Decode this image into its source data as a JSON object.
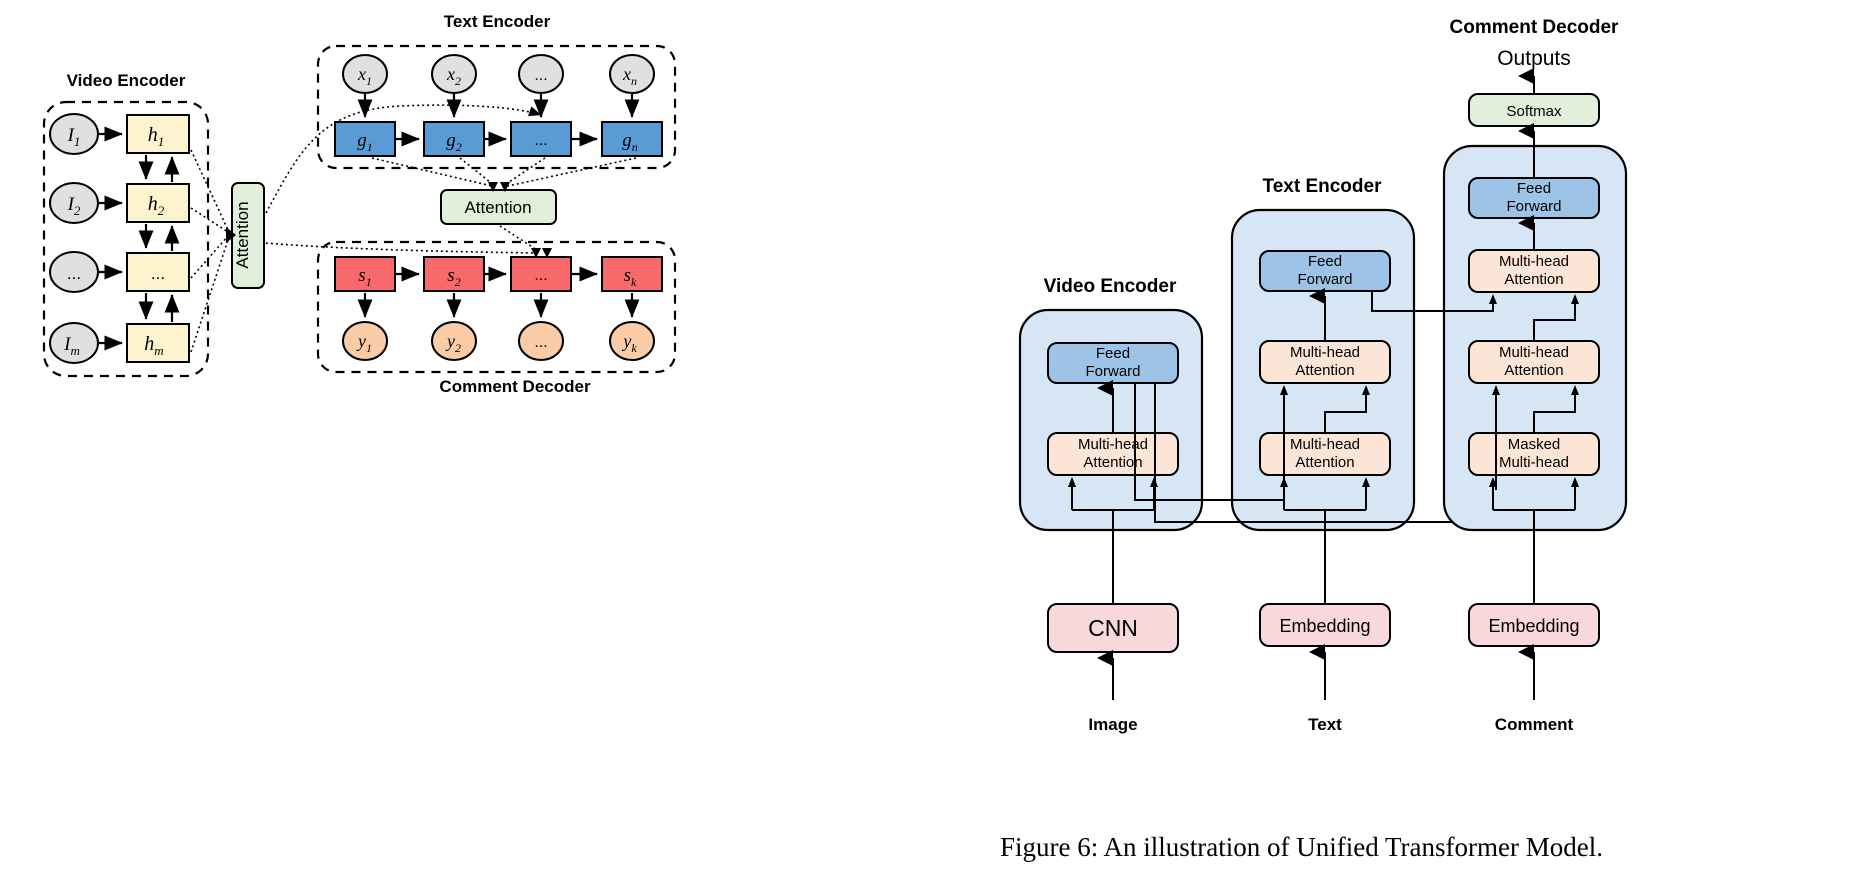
{
  "figure": {
    "caption": "Figure 6: An illustration of Unified Transformer Model."
  },
  "colors": {
    "gray_node": "#e0e0e0",
    "yellow_node": "#fdf3ce",
    "blue_node": "#5b9bd5",
    "red_node": "#f8696b",
    "orange_node": "#f9cba7",
    "green_node": "#e2efda",
    "panel_blue": "#d6e6f5",
    "ff_blue": "#9dc3e6",
    "attn_peach": "#fbe5d6",
    "embed_pink": "#f9d8dc",
    "softmax_green": "#e2efda",
    "stroke": "#000000"
  },
  "left_diagram": {
    "video_encoder": {
      "title": "Video Encoder",
      "inputs": [
        {
          "label": "I",
          "sub": "1"
        },
        {
          "label": "I",
          "sub": "2"
        },
        {
          "label": "...",
          "sub": ""
        },
        {
          "label": "I",
          "sub": "m"
        }
      ],
      "hidden": [
        {
          "label": "h",
          "sub": "1"
        },
        {
          "label": "h",
          "sub": "2"
        },
        {
          "label": "...",
          "sub": ""
        },
        {
          "label": "h",
          "sub": "m"
        }
      ]
    },
    "text_encoder": {
      "title": "Text Encoder",
      "inputs": [
        {
          "label": "x",
          "sub": "1"
        },
        {
          "label": "x",
          "sub": "2"
        },
        {
          "label": "...",
          "sub": ""
        },
        {
          "label": "x",
          "sub": "n"
        }
      ],
      "hidden": [
        {
          "label": "g",
          "sub": "1"
        },
        {
          "label": "g",
          "sub": "2"
        },
        {
          "label": "...",
          "sub": ""
        },
        {
          "label": "g",
          "sub": "n"
        }
      ]
    },
    "comment_decoder": {
      "title": "Comment Decoder",
      "states": [
        {
          "label": "s",
          "sub": "1"
        },
        {
          "label": "s",
          "sub": "2"
        },
        {
          "label": "...",
          "sub": ""
        },
        {
          "label": "s",
          "sub": "k"
        }
      ],
      "outputs": [
        {
          "label": "y",
          "sub": "1"
        },
        {
          "label": "y",
          "sub": "2"
        },
        {
          "label": "...",
          "sub": ""
        },
        {
          "label": "y",
          "sub": "k"
        }
      ]
    },
    "attention_video": {
      "label": "Attention"
    },
    "attention_text": {
      "label": "Attention"
    }
  },
  "right_diagram": {
    "columns": [
      {
        "id": "video-encoder",
        "title": "Video Encoder",
        "blocks": [
          {
            "id": "feed-forward",
            "label_lines": [
              "Feed",
              "Forward"
            ],
            "kind": "ff"
          },
          {
            "id": "multi-head-attention",
            "label_lines": [
              "Multi-head",
              "Attention"
            ],
            "kind": "attn"
          }
        ],
        "input_block": {
          "id": "cnn",
          "label": "CNN",
          "kind": "embed"
        },
        "source_label": "Image"
      },
      {
        "id": "text-encoder",
        "title": "Text Encoder",
        "blocks": [
          {
            "id": "feed-forward",
            "label_lines": [
              "Feed",
              "Forward"
            ],
            "kind": "ff"
          },
          {
            "id": "multi-head-attention-upper",
            "label_lines": [
              "Multi-head",
              "Attention"
            ],
            "kind": "attn"
          },
          {
            "id": "multi-head-attention-lower",
            "label_lines": [
              "Multi-head",
              "Attention"
            ],
            "kind": "attn"
          }
        ],
        "input_block": {
          "id": "embedding",
          "label": "Embedding",
          "kind": "embed"
        },
        "source_label": "Text"
      },
      {
        "id": "comment-decoder",
        "title": "Comment Decoder",
        "output_label": "Outputs",
        "softmax": {
          "id": "softmax",
          "label": "Softmax",
          "kind": "softmax"
        },
        "blocks": [
          {
            "id": "feed-forward",
            "label_lines": [
              "Feed",
              "Forward"
            ],
            "kind": "ff"
          },
          {
            "id": "multi-head-attention-upper",
            "label_lines": [
              "Multi-head",
              "Attention"
            ],
            "kind": "attn"
          },
          {
            "id": "multi-head-attention-mid",
            "label_lines": [
              "Multi-head",
              "Attention"
            ],
            "kind": "attn"
          },
          {
            "id": "masked-multi-head",
            "label_lines": [
              "Masked",
              "Multi-head"
            ],
            "kind": "attn"
          }
        ],
        "input_block": {
          "id": "embedding",
          "label": "Embedding",
          "kind": "embed"
        },
        "source_label": "Comment"
      }
    ]
  }
}
